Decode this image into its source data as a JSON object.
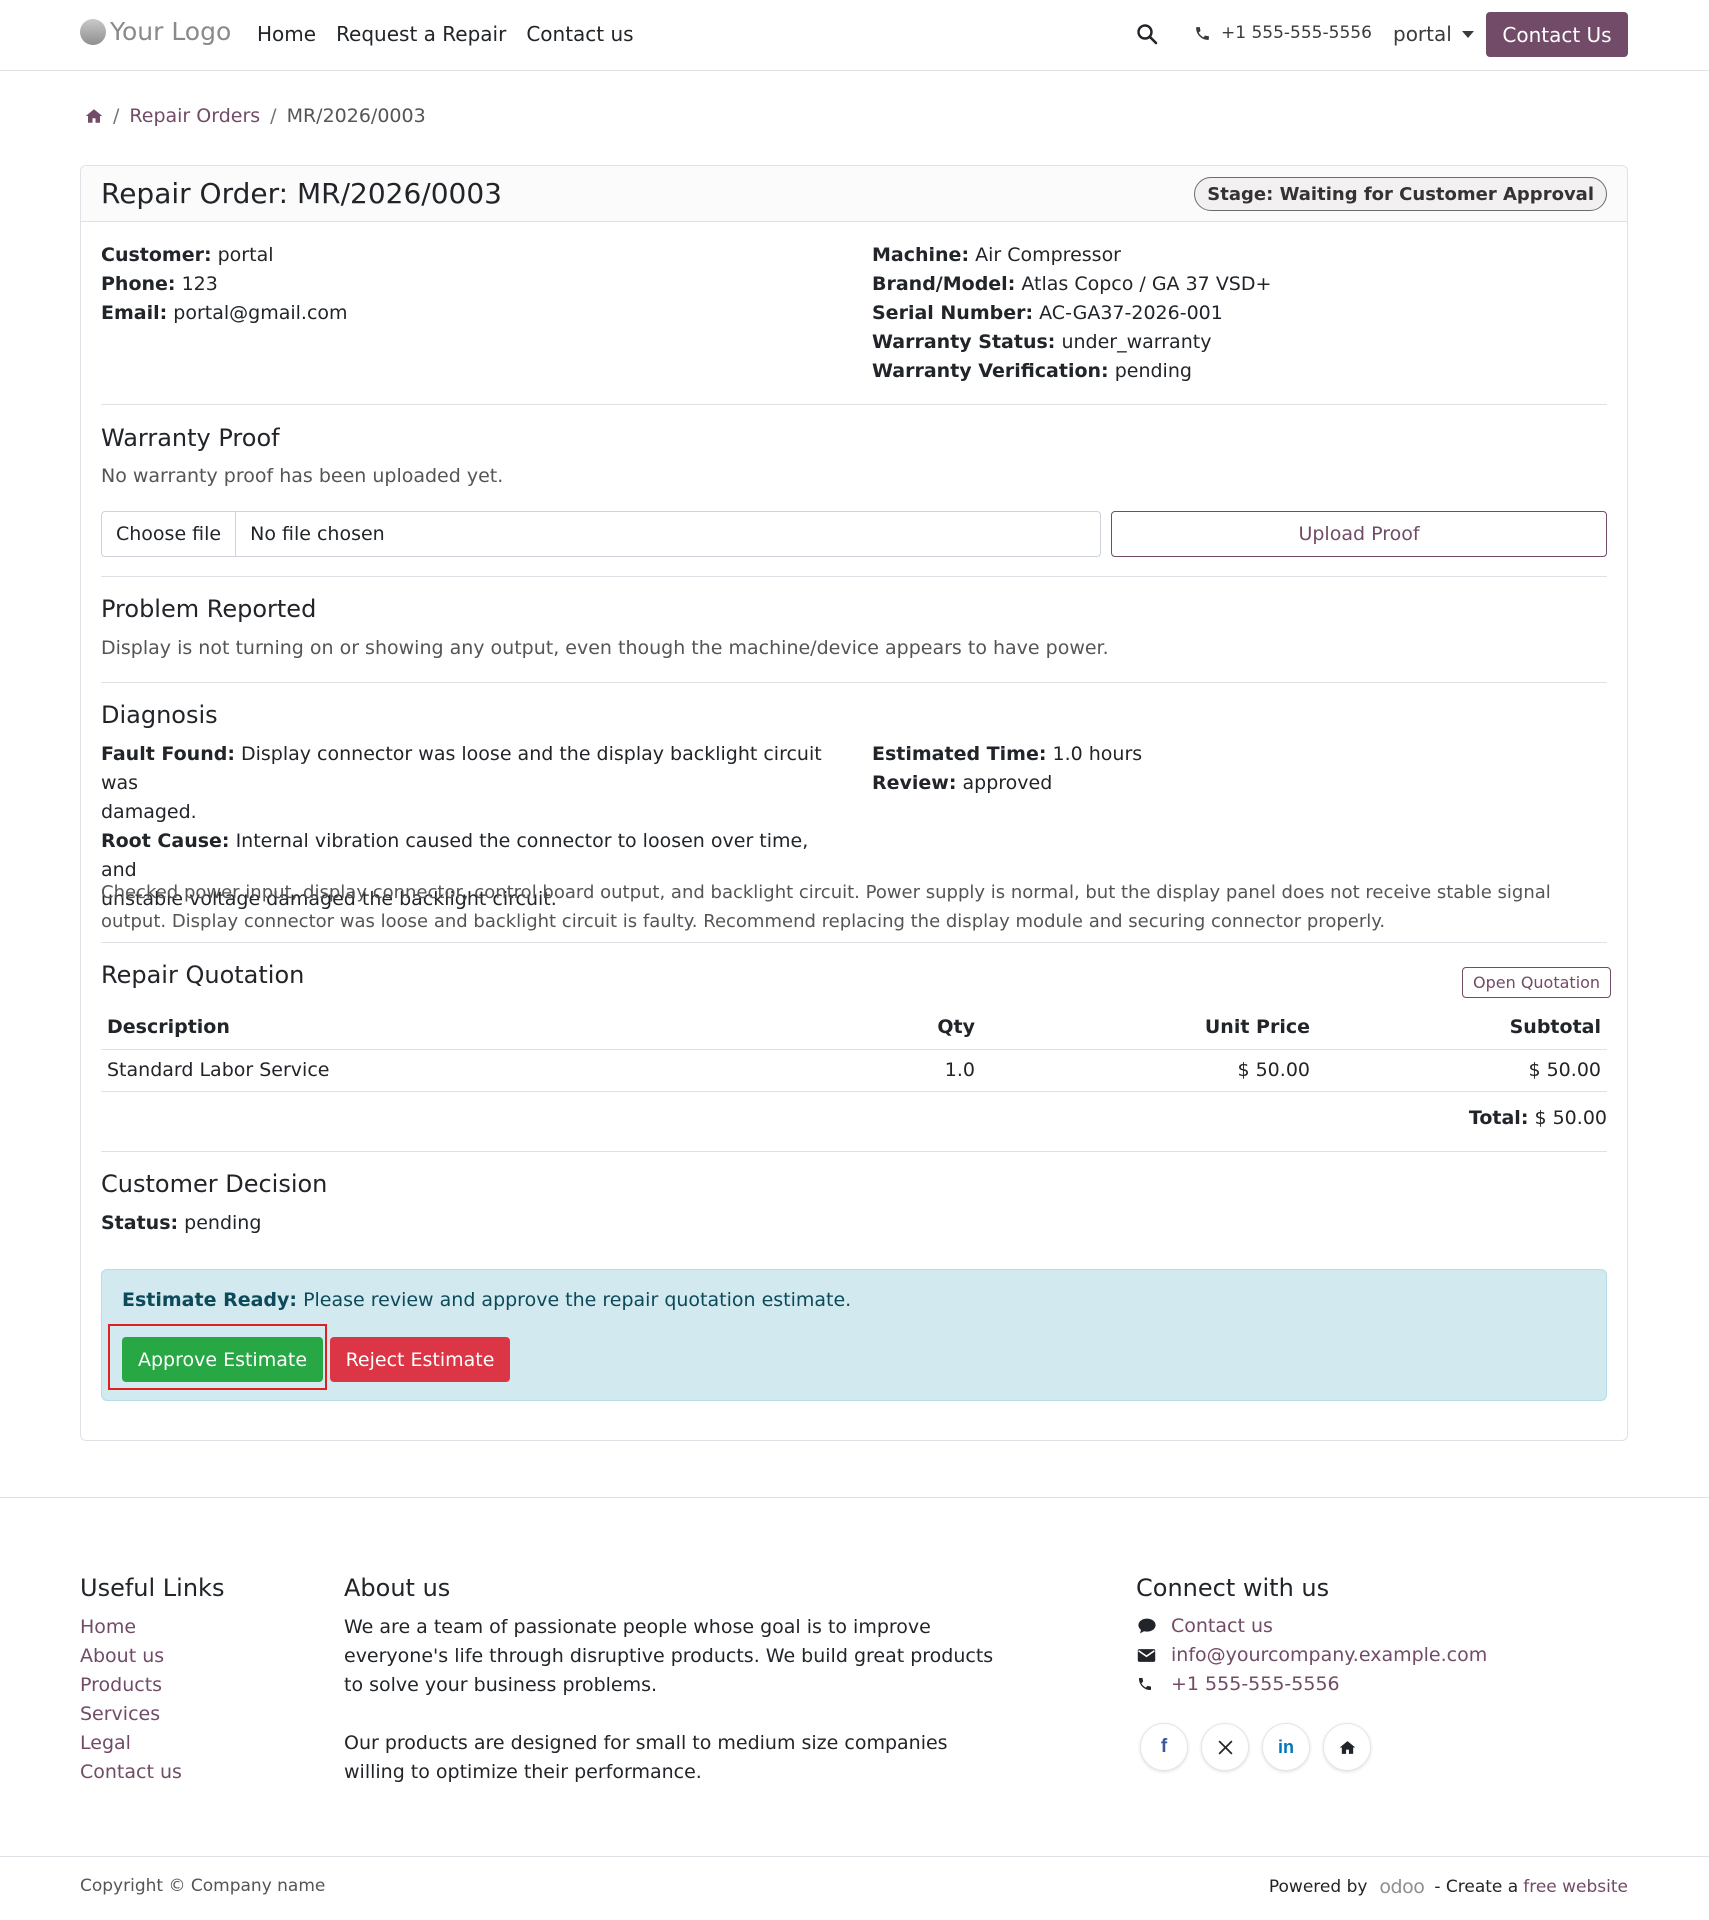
{
  "header": {
    "logo_text": "Your Logo",
    "nav": [
      "Home",
      "Request a Repair",
      "Contact us"
    ],
    "phone": "+1 555-555-5556",
    "user": "portal",
    "contact_button": "Contact Us"
  },
  "breadcrumb": {
    "sep": "/",
    "repair_orders": "Repair Orders",
    "current": "MR/2026/0003"
  },
  "order": {
    "title": "Repair Order: MR/2026/0003",
    "stage": "Stage: Waiting for Customer Approval",
    "customer": {
      "label": "Customer:",
      "value": "portal"
    },
    "phone": {
      "label": "Phone:",
      "value": "123"
    },
    "email": {
      "label": "Email:",
      "value": "portal@gmail.com"
    },
    "machine": {
      "label": "Machine:",
      "value": "Air Compressor"
    },
    "brand_model": {
      "label": "Brand/Model:",
      "value": "Atlas Copco / GA 37 VSD+"
    },
    "serial": {
      "label": "Serial Number:",
      "value": "AC-GA37-2026-001"
    },
    "warranty_status": {
      "label": "Warranty Status:",
      "value": "under_warranty"
    },
    "warranty_verification": {
      "label": "Warranty Verification:",
      "value": "pending"
    }
  },
  "warranty_proof": {
    "title": "Warranty Proof",
    "note": "No warranty proof has been uploaded yet.",
    "choose_file": "Choose file",
    "no_file": "No file chosen",
    "upload_button": "Upload Proof"
  },
  "problem": {
    "title": "Problem Reported",
    "text": "Display is not turning on or showing any output, even though the machine/device appears to have power."
  },
  "diagnosis": {
    "title": "Diagnosis",
    "fault_label": "Fault Found:",
    "fault_line1": "Display connector was loose and the display backlight circuit was",
    "fault_line2": "damaged.",
    "root_label": "Root Cause:",
    "root_line1": "Internal vibration caused the connector to loosen over time, and",
    "root_line2": "unstable voltage damaged the backlight circuit.",
    "time_label": "Estimated Time:",
    "time_value": "1.0 hours",
    "review_label": "Review:",
    "review_value": "approved",
    "notes_line1": "Checked power input, display connector, control board output, and backlight circuit. Power supply is normal, but the display panel does not receive stable signal",
    "notes_line2": "output. Display connector was loose and backlight circuit is faulty. Recommend replacing the display module and securing connector properly."
  },
  "quotation": {
    "title": "Repair Quotation",
    "open_button": "Open Quotation",
    "columns": [
      "Description",
      "Qty",
      "Unit Price",
      "Subtotal"
    ],
    "rows": [
      {
        "description": "Standard Labor Service",
        "qty": "1.0",
        "unit_price": "$ 50.00",
        "subtotal": "$ 50.00"
      }
    ],
    "total_label": "Total:",
    "total_value": "$ 50.00"
  },
  "decision": {
    "title": "Customer Decision",
    "status_label": "Status:",
    "status_value": "pending",
    "alert_label": "Estimate Ready:",
    "alert_text": "Please review and approve the repair quotation estimate.",
    "approve_button": "Approve Estimate",
    "reject_button": "Reject Estimate"
  },
  "footer": {
    "useful_title": "Useful Links",
    "useful_links": [
      "Home",
      "About us",
      "Products",
      "Services",
      "Legal",
      "Contact us"
    ],
    "about_title": "About us",
    "about_p1": [
      "We are a team of passionate people whose goal is to improve",
      "everyone's life through disruptive products. We build great products",
      "to solve your business problems."
    ],
    "about_p2": [
      "Our products are designed for small to medium size companies",
      "willing to optimize their performance."
    ],
    "connect_title": "Connect with us",
    "connect_contact": "Contact us",
    "connect_email": "info@yourcompany.example.com",
    "connect_phone": "+1 555-555-5556",
    "copyright": "Copyright © Company name",
    "powered_by": "Powered by",
    "odoo": "odoo",
    "create": "- Create a",
    "free_website": "free website"
  },
  "colors": {
    "brand": "#714b67",
    "approve": "#28a745",
    "reject": "#dc3545",
    "alert_bg": "#d1e9ef",
    "highlight": "#e02020"
  }
}
